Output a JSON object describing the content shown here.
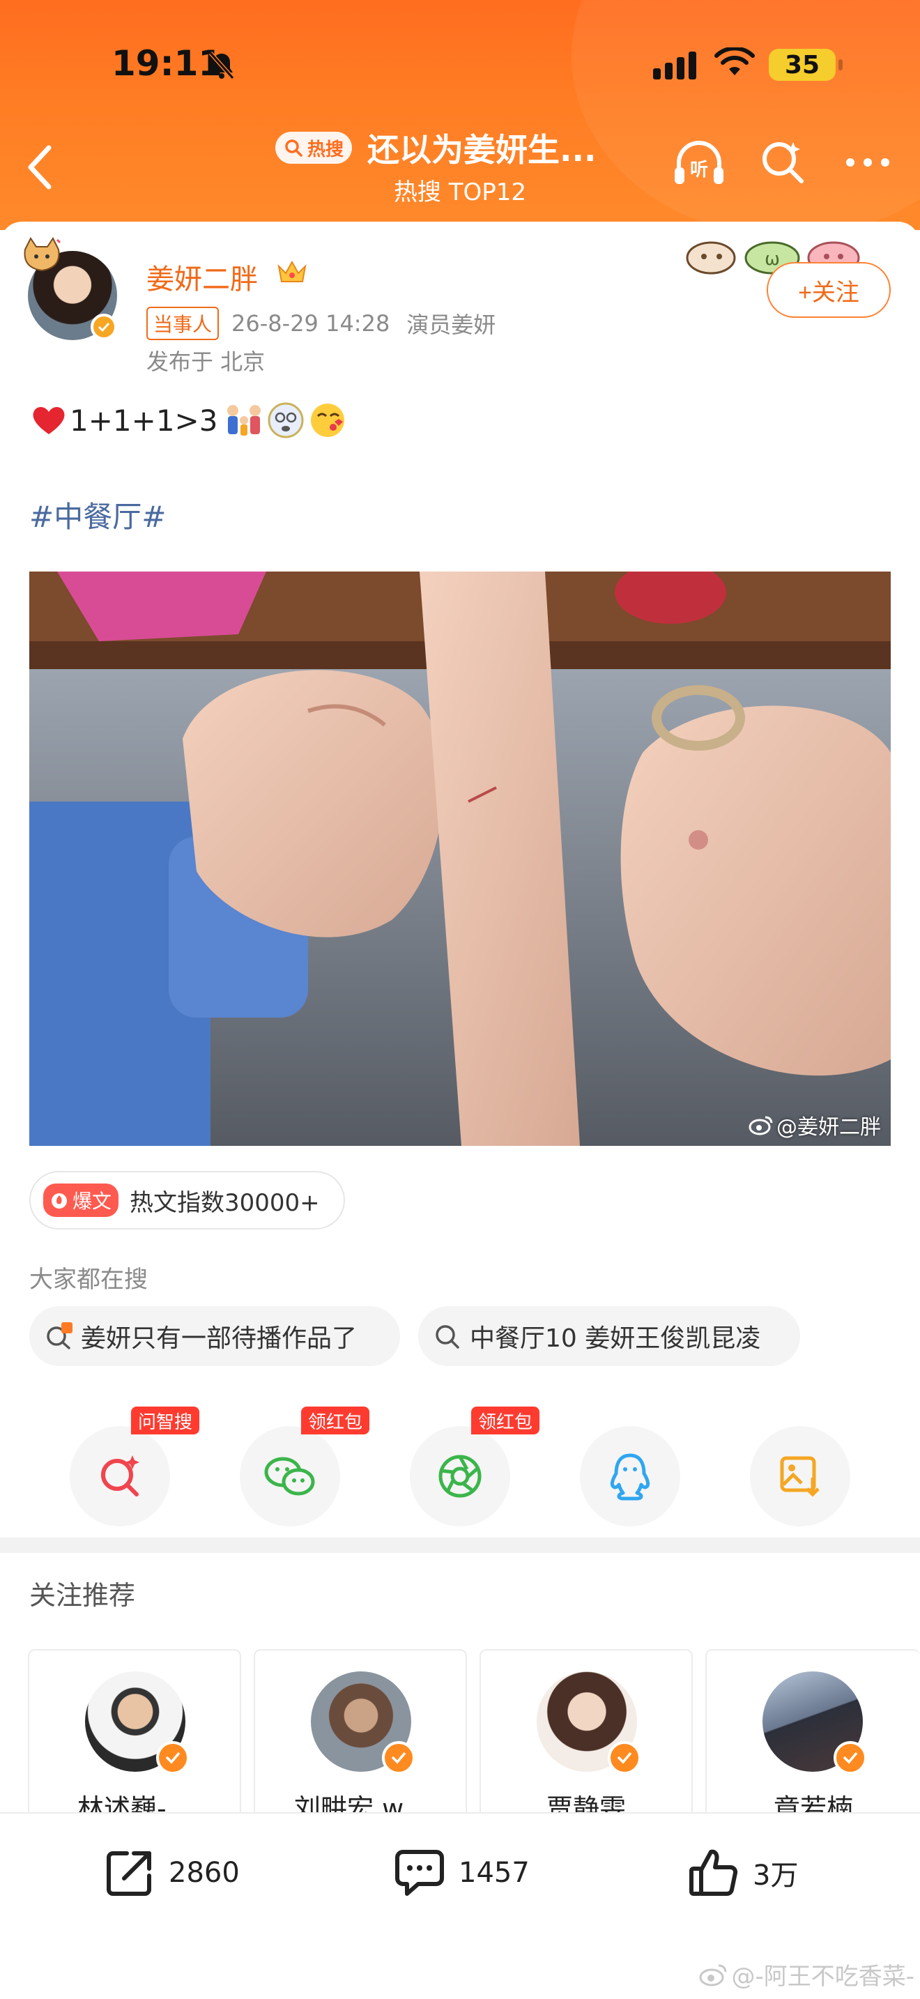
{
  "status_bar": {
    "time": "19:11",
    "battery": "35"
  },
  "nav": {
    "hot_badge": "热搜",
    "title": "还以为姜妍生...",
    "subtitle": "热搜 TOP12"
  },
  "post": {
    "author": "姜妍二胖",
    "follow_label": "+关注",
    "party_tag": "当事人",
    "date": "26-8-29 14:28",
    "source": "演员姜妍",
    "location": "发布于 北京",
    "text": "1+1+1>3",
    "hashtag": "#中餐厅#",
    "image_watermark": "@姜妍二胖"
  },
  "hot_index": {
    "badge": "爆文",
    "label": "热文指数30000+"
  },
  "search_section": {
    "title": "大家都在搜",
    "chips": [
      {
        "label": "姜妍只有一部待播作品了"
      },
      {
        "label": "中餐厅10 姜妍王俊凯昆凌"
      }
    ]
  },
  "share": [
    {
      "icon": "ai-search-icon",
      "badge": "问智搜",
      "color": "#f0444e"
    },
    {
      "icon": "wechat-icon",
      "badge": "领红包",
      "color": "#3bb54a"
    },
    {
      "icon": "moments-icon",
      "badge": "领红包",
      "color": "#3bb54a"
    },
    {
      "icon": "qq-icon",
      "badge": "",
      "color": "#2fa6f0"
    },
    {
      "icon": "save-image-icon",
      "badge": "",
      "color": "#f5a623"
    }
  ],
  "recommend": {
    "title": "关注推荐",
    "users": [
      {
        "name": "林述巍-..."
      },
      {
        "name": "刘畊宏 w..."
      },
      {
        "name": "贾静雯"
      },
      {
        "name": "章若楠"
      }
    ]
  },
  "actions": {
    "reposts": "2860",
    "comments": "1457",
    "likes": "3万"
  },
  "watermark": "@-阿王不吃香菜-",
  "colors": {
    "brand_orange": "#ff7a22",
    "accent_text": "#f06a18",
    "hashtag": "#4a6a9f",
    "badge_red": "#ff3b30"
  }
}
